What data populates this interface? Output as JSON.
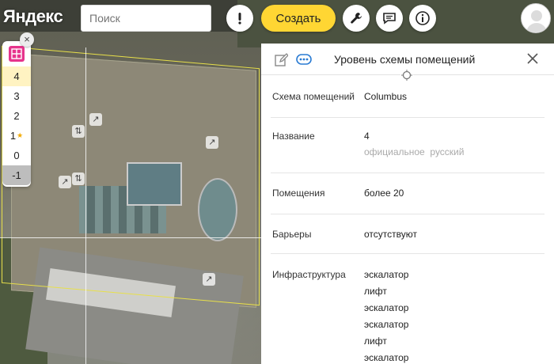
{
  "header": {
    "logo": "Яндекс",
    "search_placeholder": "Поиск",
    "create_label": "Создать",
    "icons": [
      "alert-icon",
      "wrench-icon",
      "chat-icon",
      "info-icon"
    ]
  },
  "floors": {
    "items": [
      "4",
      "3",
      "2",
      "1",
      "0",
      "-1"
    ],
    "active": "4",
    "starred": "1",
    "close_label": "×"
  },
  "panel": {
    "title": "Уровень схемы помещений",
    "close_label": "✕",
    "rows": {
      "scheme": {
        "label": "Схема помещений",
        "value": "Columbus"
      },
      "name": {
        "label": "Название",
        "value": "4",
        "lang1": "официальное",
        "lang2": "русский"
      },
      "rooms": {
        "label": "Помещения",
        "value": "более 20"
      },
      "barriers": {
        "label": "Барьеры",
        "value": "отсутствуют"
      },
      "infra": {
        "label": "Инфраструктура",
        "items": [
          "эскалатор",
          "лифт",
          "эскалатор",
          "эскалатор",
          "лифт",
          "эскалатор"
        ]
      }
    }
  },
  "colors": {
    "accent": "#ffd633",
    "link": "#2a7bd3",
    "floor_icon": "#e6348c",
    "outline": "#e8e04a"
  }
}
